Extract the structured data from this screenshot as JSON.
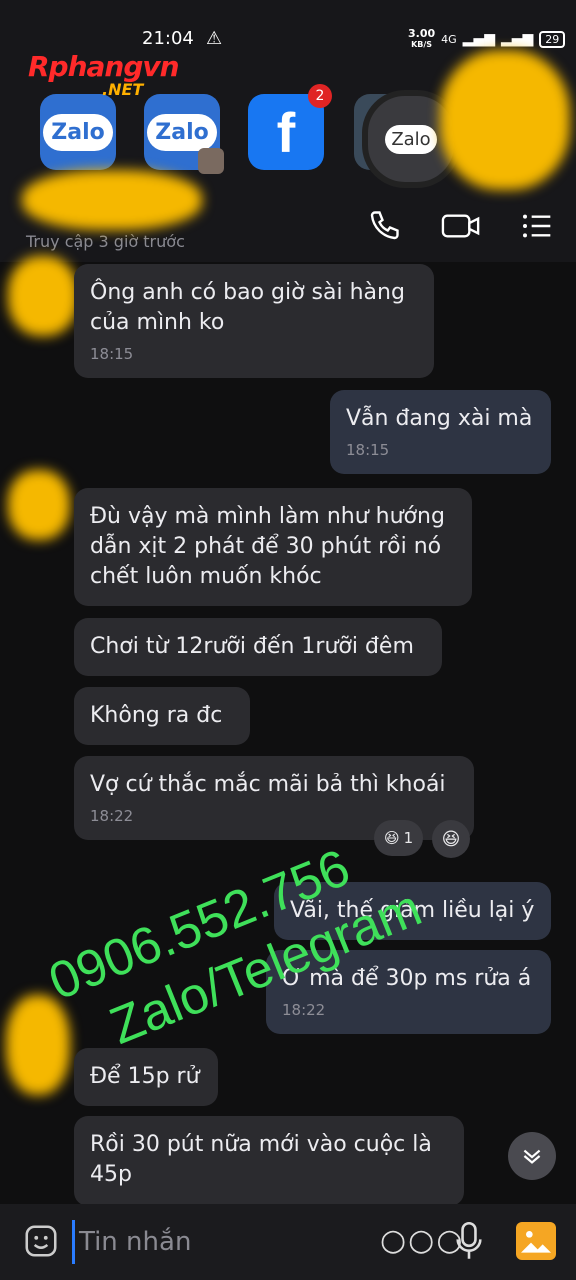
{
  "status_bar": {
    "time": "21:04",
    "net_speed_value": "3.00",
    "net_speed_unit": "KB/S",
    "network": "4G",
    "battery": "29"
  },
  "watermark_logo": {
    "main": "Rphangvn",
    "sub": ".NET"
  },
  "app_row": [
    {
      "label": "Zalo",
      "icon": "zalo-icon"
    },
    {
      "label": "Zalo",
      "icon": "zalo-icon"
    },
    {
      "label": "f",
      "icon": "facebook-icon",
      "badge": "2"
    },
    {
      "label": "Zalo",
      "icon": "zalo-icon"
    }
  ],
  "header": {
    "last_seen": "Truy cập 3 giờ trước",
    "actions": [
      "phone-icon",
      "video-call-icon",
      "menu-icon"
    ]
  },
  "messages": [
    {
      "side": "them",
      "text": "Ông anh có bao giờ sài hàng của mình ko",
      "time": "18:15"
    },
    {
      "side": "me",
      "text": "Vẫn đang xài mà",
      "time": "18:15"
    },
    {
      "side": "them",
      "text": "Đù vậy mà mình làm như hướng dẫn xịt 2 phát để 30 phút rồi nó chết luôn muốn khóc",
      "time": ""
    },
    {
      "side": "them",
      "text": "Chơi từ 12rưỡi đến 1rưỡi đêm",
      "time": ""
    },
    {
      "side": "them",
      "text": "Không ra đc",
      "time": ""
    },
    {
      "side": "them",
      "text": "Vợ cứ thắc mắc mãi bả thì khoái",
      "time": "18:22",
      "reaction_count": "1"
    },
    {
      "side": "me",
      "text": "Vãi, thế giảm liều lại ý",
      "time": ""
    },
    {
      "side": "me",
      "text": "Ơ mà để 30p ms rửa á",
      "time": "18:22"
    },
    {
      "side": "them",
      "text": "Để 15p rử",
      "time": ""
    },
    {
      "side": "them",
      "text": "Rồi 30 pút nữa mới vào cuộc là 45p",
      "time": ""
    }
  ],
  "watermark": {
    "line1": "0906.552.756",
    "line2": "Zalo/Telegram"
  },
  "input": {
    "placeholder": "Tin nhắn"
  },
  "colors": {
    "watermark_green": "#3fe05a",
    "accent_blue": "#2a7cff",
    "blur_yellow": "#f5b800"
  }
}
